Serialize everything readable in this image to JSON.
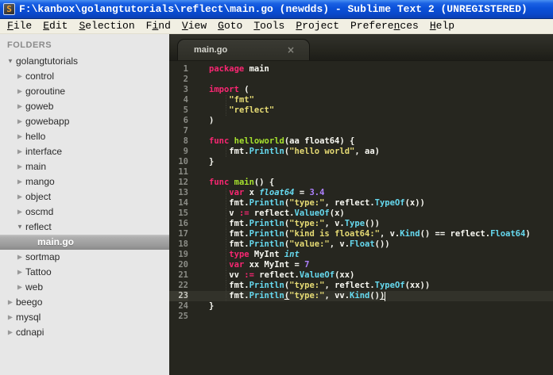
{
  "window": {
    "title": "F:\\kanbox\\golangtutorials\\reflect\\main.go (newdds) - Sublime Text 2 (UNREGISTERED)",
    "app_icon_glyph": "S"
  },
  "menu": {
    "items": [
      {
        "label": "File",
        "mnemonic_index": 0
      },
      {
        "label": "Edit",
        "mnemonic_index": 0
      },
      {
        "label": "Selection",
        "mnemonic_index": 0
      },
      {
        "label": "Find",
        "mnemonic_index": 1
      },
      {
        "label": "View",
        "mnemonic_index": 0
      },
      {
        "label": "Goto",
        "mnemonic_index": 0
      },
      {
        "label": "Tools",
        "mnemonic_index": 0
      },
      {
        "label": "Project",
        "mnemonic_index": 0
      },
      {
        "label": "Preferences",
        "mnemonic_index": 7
      },
      {
        "label": "Help",
        "mnemonic_index": 0
      }
    ]
  },
  "sidebar": {
    "header": "FOLDERS",
    "items": [
      {
        "label": "golangtutorials",
        "level": 0,
        "state": "expanded",
        "selected": false
      },
      {
        "label": "control",
        "level": 1,
        "state": "collapsed",
        "selected": false
      },
      {
        "label": "goroutine",
        "level": 1,
        "state": "collapsed",
        "selected": false
      },
      {
        "label": "goweb",
        "level": 1,
        "state": "collapsed",
        "selected": false
      },
      {
        "label": "gowebapp",
        "level": 1,
        "state": "collapsed",
        "selected": false
      },
      {
        "label": "hello",
        "level": 1,
        "state": "collapsed",
        "selected": false
      },
      {
        "label": "interface",
        "level": 1,
        "state": "collapsed",
        "selected": false
      },
      {
        "label": "main",
        "level": 1,
        "state": "collapsed",
        "selected": false
      },
      {
        "label": "mango",
        "level": 1,
        "state": "collapsed",
        "selected": false
      },
      {
        "label": "object",
        "level": 1,
        "state": "collapsed",
        "selected": false
      },
      {
        "label": "oscmd",
        "level": 1,
        "state": "collapsed",
        "selected": false
      },
      {
        "label": "reflect",
        "level": 1,
        "state": "expanded",
        "selected": false
      },
      {
        "label": "main.go",
        "level": 2,
        "state": "file",
        "selected": true
      },
      {
        "label": "sortmap",
        "level": 1,
        "state": "collapsed",
        "selected": false
      },
      {
        "label": "Tattoo",
        "level": 1,
        "state": "collapsed",
        "selected": false
      },
      {
        "label": "web",
        "level": 1,
        "state": "collapsed",
        "selected": false
      },
      {
        "label": "beego",
        "level": 0,
        "state": "collapsed",
        "selected": false
      },
      {
        "label": "mysql",
        "level": 0,
        "state": "collapsed",
        "selected": false
      },
      {
        "label": "cdnapi",
        "level": 0,
        "state": "collapsed",
        "selected": false
      }
    ]
  },
  "tab": {
    "label": "main.go",
    "close_glyph": "×"
  },
  "theme": {
    "titlebar_blue": "#0b50d8",
    "menubar_bg": "#f1efe3",
    "sidebar_bg": "#e7e7e7",
    "editor_bg": "#26261f",
    "gutter_fg": "#8b8c86",
    "current_line_bg": "#32322a",
    "keyword_pink": "#f92672",
    "function_green": "#a6e22e",
    "string_yellow": "#e6db74",
    "method_cyan": "#66d9ef",
    "number_purple": "#ae81ff",
    "plain_fg": "#f8f8f2"
  },
  "code": {
    "lines": [
      {
        "n": 1,
        "g": false,
        "cur": false,
        "seg": [
          [
            "k",
            "package"
          ],
          [
            "p",
            " main"
          ]
        ]
      },
      {
        "n": 2,
        "g": false,
        "cur": false,
        "seg": []
      },
      {
        "n": 3,
        "g": false,
        "cur": false,
        "seg": [
          [
            "k",
            "import"
          ],
          [
            "p",
            " ("
          ]
        ]
      },
      {
        "n": 4,
        "g": true,
        "cur": false,
        "seg": [
          [
            "p",
            "    "
          ],
          [
            "s",
            "\"fmt\""
          ]
        ]
      },
      {
        "n": 5,
        "g": true,
        "cur": false,
        "seg": [
          [
            "p",
            "    "
          ],
          [
            "s",
            "\"reflect\""
          ]
        ]
      },
      {
        "n": 6,
        "g": false,
        "cur": false,
        "seg": [
          [
            "p",
            ")"
          ]
        ]
      },
      {
        "n": 7,
        "g": false,
        "cur": false,
        "seg": []
      },
      {
        "n": 8,
        "g": false,
        "cur": false,
        "seg": [
          [
            "k",
            "func"
          ],
          [
            "p",
            " "
          ],
          [
            "f",
            "helloworld"
          ],
          [
            "p",
            "(aa float64) {"
          ]
        ]
      },
      {
        "n": 9,
        "g": true,
        "cur": false,
        "seg": [
          [
            "p",
            "    fmt."
          ],
          [
            "m",
            "Println"
          ],
          [
            "p",
            "("
          ],
          [
            "s",
            "\"hello world\""
          ],
          [
            "p",
            ", aa)"
          ]
        ]
      },
      {
        "n": 10,
        "g": false,
        "cur": false,
        "seg": [
          [
            "p",
            "}"
          ]
        ]
      },
      {
        "n": 11,
        "g": false,
        "cur": false,
        "seg": []
      },
      {
        "n": 12,
        "g": false,
        "cur": false,
        "seg": [
          [
            "k",
            "func"
          ],
          [
            "p",
            " "
          ],
          [
            "f",
            "main"
          ],
          [
            "p",
            "() {"
          ]
        ]
      },
      {
        "n": 13,
        "g": true,
        "cur": false,
        "seg": [
          [
            "p",
            "    "
          ],
          [
            "k",
            "var"
          ],
          [
            "p",
            " x "
          ],
          [
            "t",
            "float64"
          ],
          [
            "p",
            " = "
          ],
          [
            "n",
            "3.4"
          ]
        ]
      },
      {
        "n": 14,
        "g": true,
        "cur": false,
        "seg": [
          [
            "p",
            "    fmt."
          ],
          [
            "m",
            "Println"
          ],
          [
            "p",
            "("
          ],
          [
            "s",
            "\"type:\""
          ],
          [
            "p",
            ", reflect."
          ],
          [
            "m",
            "TypeOf"
          ],
          [
            "p",
            "(x))"
          ]
        ]
      },
      {
        "n": 15,
        "g": true,
        "cur": false,
        "seg": [
          [
            "p",
            "    v "
          ],
          [
            "k",
            ":="
          ],
          [
            "p",
            " reflect."
          ],
          [
            "m",
            "ValueOf"
          ],
          [
            "p",
            "(x)"
          ]
        ]
      },
      {
        "n": 16,
        "g": true,
        "cur": false,
        "seg": [
          [
            "p",
            "    fmt."
          ],
          [
            "m",
            "Println"
          ],
          [
            "p",
            "("
          ],
          [
            "s",
            "\"type:\""
          ],
          [
            "p",
            ", v."
          ],
          [
            "m",
            "Type"
          ],
          [
            "p",
            "())"
          ]
        ]
      },
      {
        "n": 17,
        "g": true,
        "cur": false,
        "seg": [
          [
            "p",
            "    fmt."
          ],
          [
            "m",
            "Println"
          ],
          [
            "p",
            "("
          ],
          [
            "s",
            "\"kind is float64:\""
          ],
          [
            "p",
            ", v."
          ],
          [
            "m",
            "Kind"
          ],
          [
            "p",
            "() == reflect."
          ],
          [
            "m",
            "Float64"
          ],
          [
            "p",
            ")"
          ]
        ]
      },
      {
        "n": 18,
        "g": true,
        "cur": false,
        "seg": [
          [
            "p",
            "    fmt."
          ],
          [
            "m",
            "Println"
          ],
          [
            "p",
            "("
          ],
          [
            "s",
            "\"value:\""
          ],
          [
            "p",
            ", v."
          ],
          [
            "m",
            "Float"
          ],
          [
            "p",
            "())"
          ]
        ]
      },
      {
        "n": 19,
        "g": true,
        "cur": false,
        "seg": [
          [
            "p",
            "    "
          ],
          [
            "k",
            "type"
          ],
          [
            "p",
            " MyInt "
          ],
          [
            "t",
            "int"
          ]
        ]
      },
      {
        "n": 20,
        "g": true,
        "cur": false,
        "seg": [
          [
            "p",
            "    "
          ],
          [
            "k",
            "var"
          ],
          [
            "p",
            " xx MyInt = "
          ],
          [
            "n",
            "7"
          ]
        ]
      },
      {
        "n": 21,
        "g": true,
        "cur": false,
        "seg": [
          [
            "p",
            "    vv "
          ],
          [
            "k",
            ":="
          ],
          [
            "p",
            " reflect."
          ],
          [
            "m",
            "ValueOf"
          ],
          [
            "p",
            "(xx)"
          ]
        ]
      },
      {
        "n": 22,
        "g": true,
        "cur": false,
        "seg": [
          [
            "p",
            "    fmt."
          ],
          [
            "m",
            "Println"
          ],
          [
            "p",
            "("
          ],
          [
            "s",
            "\"type:\""
          ],
          [
            "p",
            ", reflect."
          ],
          [
            "m",
            "TypeOf"
          ],
          [
            "p",
            "(xx))"
          ]
        ]
      },
      {
        "n": 23,
        "g": true,
        "cur": true,
        "seg": [
          [
            "p",
            "    fmt."
          ],
          [
            "m",
            "Println"
          ],
          [
            "u",
            "("
          ],
          [
            "s",
            "\"type:\""
          ],
          [
            "p",
            ", vv."
          ],
          [
            "m",
            "Kind"
          ],
          [
            "p",
            "()"
          ],
          [
            "u",
            ")"
          ]
        ]
      },
      {
        "n": 24,
        "g": false,
        "cur": false,
        "seg": [
          [
            "p",
            "}"
          ]
        ]
      },
      {
        "n": 25,
        "g": false,
        "cur": false,
        "seg": []
      }
    ]
  }
}
